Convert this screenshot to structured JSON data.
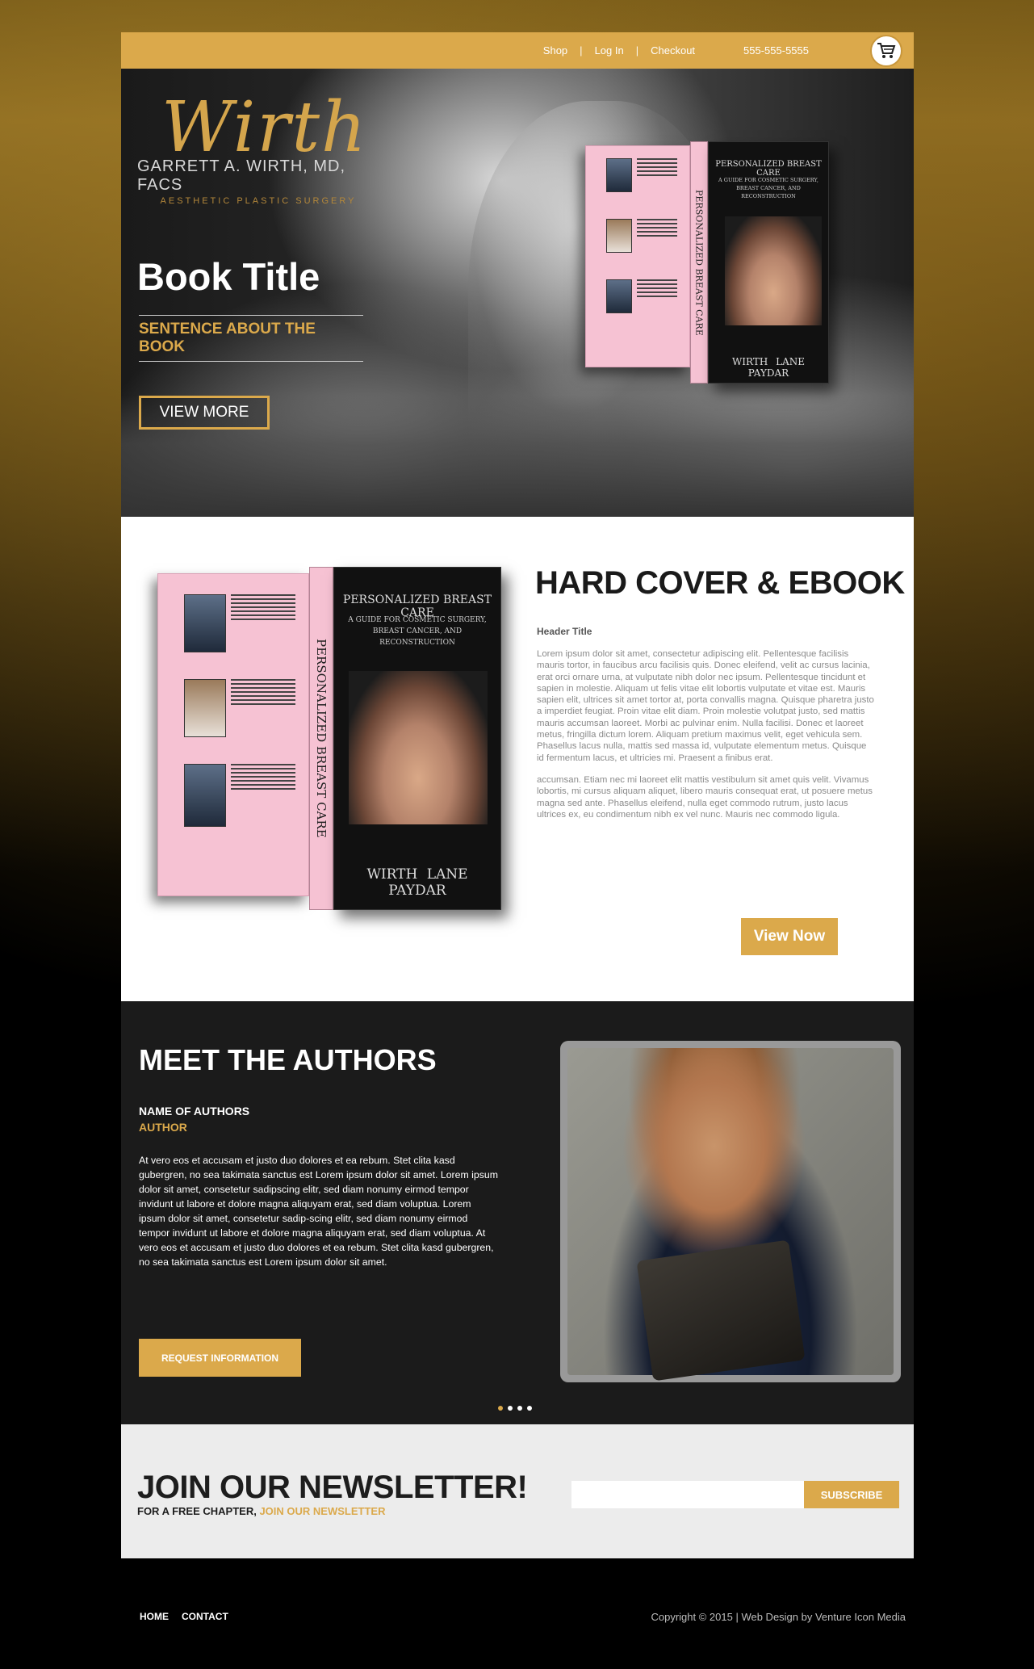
{
  "colors": {
    "gold": "#dba94b",
    "dark": "#1b1b1b",
    "light": "#ececec"
  },
  "topbar": {
    "nav": [
      "Shop",
      "Log In",
      "Checkout"
    ],
    "separator": "|",
    "phone": "555-555-5555",
    "cart_icon": "shopping-cart-icon"
  },
  "hero": {
    "logo": {
      "script": "Wirth",
      "name": "GARRETT A. WIRTH, MD, FACS",
      "tagline": "AESTHETIC PLASTIC SURGERY"
    },
    "title": "Book Title",
    "sentence": "SENTENCE ABOUT THE BOOK",
    "cta": "VIEW MORE"
  },
  "book": {
    "title": "PERSONALIZED BREAST CARE",
    "subtitle": "A GUIDE FOR COSMETIC SURGERY, BREAST CANCER, AND RECONSTRUCTION",
    "spine_title": "PERSONALIZED BREAST CARE",
    "spine_authors": "WIRTH LANE PAYDAR",
    "authors": "WIRTH LANE PAYDAR"
  },
  "hardcover": {
    "title": "HARD COVER & EBOOK",
    "subhead": "Header Title",
    "paragraphs": [
      "Lorem ipsum dolor sit amet, consectetur adipiscing elit. Pellentesque facilisis mauris tortor, in faucibus arcu facilisis quis. Donec eleifend, velit ac cursus lacinia, erat orci ornare urna, at vulputate nibh dolor nec ipsum. Pellentesque tincidunt et sapien in molestie. Aliquam ut felis vitae elit lobortis vulputate et vitae est. Mauris sapien elit, ultrices sit amet tortor at, porta convallis magna. Quisque pharetra justo a imperdiet feugiat. Proin vitae elit diam. Proin molestie volutpat justo, sed mattis mauris accumsan laoreet. Morbi ac pulvinar enim. Nulla facilisi. Donec et laoreet metus, fringilla dictum lorem. Aliquam pretium maximus velit, eget vehicula sem. Phasellus lacus nulla, mattis sed massa id, vulputate elementum metus. Quisque id fermentum lacus, et ultricies mi. Praesent a finibus erat.",
      "accumsan. Etiam nec mi laoreet elit mattis vestibulum sit amet quis velit. Vivamus lobortis, mi cursus aliquam aliquet, libero mauris consequat erat, ut posuere metus magna sed ante. Phasellus eleifend, nulla eget commodo rutrum, justo lacus ultrices ex, eu condimentum nibh ex vel nunc. Mauris nec commodo ligula."
    ],
    "cta": "View Now"
  },
  "authors": {
    "title": "MEET THE AUTHORS",
    "name": "NAME OF AUTHORS",
    "role": "AUTHOR",
    "body": "At vero eos et accusam et justo duo dolores et ea rebum. Stet clita kasd gubergren, no sea takimata sanctus est Lorem ipsum dolor sit amet. Lorem ipsum dolor sit amet, consetetur sadipscing elitr, sed diam nonumy eirmod tempor invidunt ut labore et dolore magna aliquyam erat, sed diam voluptua. Lorem ipsum dolor sit amet, consetetur sadip-scing elitr, sed diam nonumy eirmod tempor invidunt ut labore et dolore magna aliquyam erat, sed diam voluptua. At vero eos et accusam et justo duo dolores et ea rebum. Stet clita kasd gubergren, no sea takimata sanctus est Lorem ipsum dolor sit amet.",
    "cta": "REQUEST INFORMATION",
    "carousel_active": 1,
    "carousel_count": 4
  },
  "newsletter": {
    "title": "JOIN OUR NEWSLETTER!",
    "sub_prefix": "FOR A FREE CHAPTER,",
    "sub_link": "JOIN OUR NEWSLETTER",
    "input_placeholder": "",
    "cta": "SUBSCRIBE"
  },
  "footer": {
    "nav": [
      "HOME",
      "CONTACT"
    ],
    "copyright": "Copyright © 2015 | Web Design by Venture Icon Media"
  }
}
